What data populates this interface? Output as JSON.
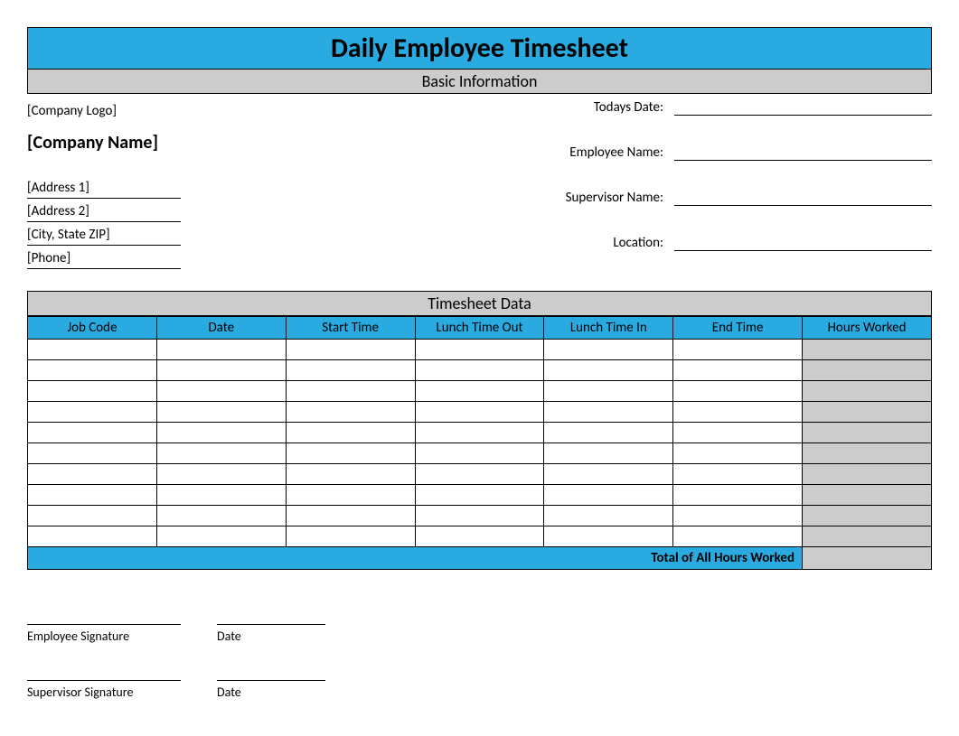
{
  "title": "Daily Employee Timesheet",
  "sections": {
    "basic": "Basic Information",
    "data": "Timesheet Data"
  },
  "company": {
    "logo": "[Company Logo]",
    "name": "[Company Name]",
    "addr1": "[Address 1]",
    "addr2": "[Address 2]",
    "city": "[City, State ZIP]",
    "phone": "[Phone]"
  },
  "fields": {
    "date": "Todays Date:",
    "employee": "Employee Name:",
    "supervisor": "Supervisor Name:",
    "location": "Location:"
  },
  "columns": [
    "Job Code",
    "Date",
    "Start Time",
    "Lunch Time Out",
    "Lunch Time In",
    "End Time",
    "Hours Worked"
  ],
  "rowCount": 10,
  "totalLabel": "Total of All Hours Worked",
  "sig": {
    "emp": "Employee Signature",
    "sup": "Supervisor Signature",
    "date": "Date"
  }
}
